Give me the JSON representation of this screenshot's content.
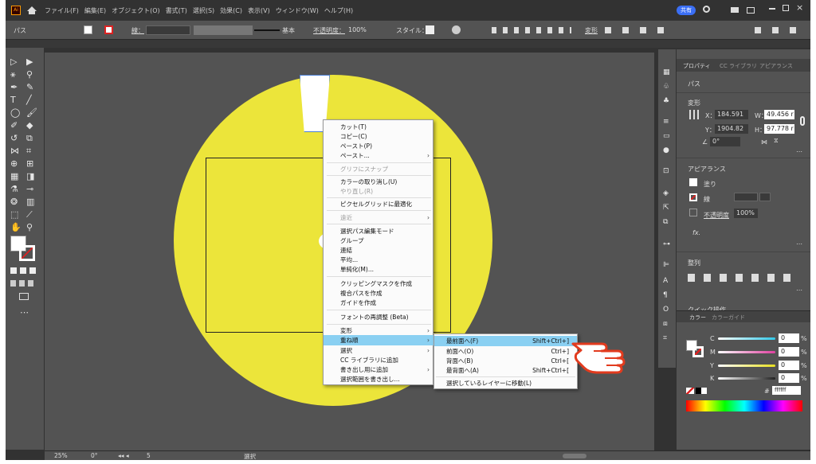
{
  "menubar": {
    "app_badge": "Ai",
    "items": [
      "ファイル(F)",
      "編集(E)",
      "オブジェクト(O)",
      "書式(T)",
      "選択(S)",
      "効果(C)",
      "表示(V)",
      "ウィンドウ(W)",
      "ヘルプ(H)"
    ],
    "share_label": "共有"
  },
  "control_bar": {
    "selection_type": "パス",
    "stroke_label": "線：",
    "stroke_style": "基本",
    "opacity_label": "不透明度：",
    "opacity_value": "100%",
    "style_label": "スタイル：",
    "transform_label": "変形"
  },
  "context_menu": {
    "items": [
      {
        "label": "カット(T)",
        "disabled": false,
        "submenu": false
      },
      {
        "label": "コピー(C)",
        "disabled": false,
        "submenu": false
      },
      {
        "label": "ペースト(P)",
        "disabled": false,
        "submenu": false
      },
      {
        "label": "ペースト...",
        "disabled": false,
        "submenu": true
      },
      {
        "label": "グリフにスナップ",
        "disabled": true,
        "submenu": false
      },
      {
        "label": "カラーの取り消し(U)",
        "disabled": false,
        "submenu": false
      },
      {
        "label": "やり直し(R)",
        "disabled": true,
        "submenu": false
      },
      {
        "label": "ピクセルグリッドに最適化",
        "disabled": false,
        "submenu": false
      },
      {
        "label": "遠近",
        "disabled": true,
        "submenu": true
      },
      {
        "label": "選択パス編集モード",
        "disabled": false,
        "submenu": false
      },
      {
        "label": "グループ",
        "disabled": false,
        "submenu": false
      },
      {
        "label": "連結",
        "disabled": false,
        "submenu": false
      },
      {
        "label": "平均...",
        "disabled": false,
        "submenu": false
      },
      {
        "label": "単純化(M)...",
        "disabled": false,
        "submenu": false
      },
      {
        "label": "クリッピングマスクを作成",
        "disabled": false,
        "submenu": false
      },
      {
        "label": "複合パスを作成",
        "disabled": false,
        "submenu": false
      },
      {
        "label": "ガイドを作成",
        "disabled": false,
        "submenu": false
      },
      {
        "label": "フォントの再調整 (Beta)",
        "disabled": false,
        "submenu": false
      },
      {
        "label": "変形",
        "disabled": false,
        "submenu": true
      },
      {
        "label": "重ね順",
        "disabled": false,
        "submenu": true,
        "selected": true
      },
      {
        "label": "選択",
        "disabled": false,
        "submenu": true
      },
      {
        "label": "CC ライブラリに追加",
        "disabled": false,
        "submenu": false
      },
      {
        "label": "書き出し用に追加",
        "disabled": false,
        "submenu": true
      },
      {
        "label": "選択範囲を書き出し...",
        "disabled": false,
        "submenu": false
      }
    ]
  },
  "submenu": {
    "items": [
      {
        "label": "最前面へ(F)",
        "shortcut": "Shift+Ctrl+]",
        "selected": true
      },
      {
        "label": "前面へ(O)",
        "shortcut": "Ctrl+]"
      },
      {
        "label": "背面へ(B)",
        "shortcut": "Ctrl+["
      },
      {
        "label": "最背面へ(A)",
        "shortcut": "Shift+Ctrl+["
      },
      {
        "label": "選択しているレイヤーに移動(L)",
        "shortcut": ""
      }
    ]
  },
  "properties_panel": {
    "tabs": [
      "プロパティ",
      "CC ライブラリ",
      "アピアランス"
    ],
    "section_path": "パス",
    "section_transform": "変形",
    "x_label": "X：",
    "x_value": "184.591",
    "y_label": "Y：",
    "y_value": "1904.82",
    "w_label": "W：",
    "w_value": "49.456 r",
    "h_label": "H：",
    "h_value": "97.778 r",
    "angle_value": "0°",
    "section_appearance": "アピアランス",
    "fill_label": "塗り",
    "stroke_label": "線",
    "opacity_label": "不透明度",
    "opacity_value": "100%",
    "fx_label": "fx.",
    "section_align": "整列",
    "quick_actions": "クイック操作"
  },
  "color_panel": {
    "tabs": [
      "カラー",
      "カラーガイド"
    ],
    "channels": [
      {
        "label": "C",
        "value": "0",
        "unit": "%",
        "color": "#30c8e8"
      },
      {
        "label": "M",
        "value": "0",
        "unit": "%",
        "color": "#e040a0"
      },
      {
        "label": "Y",
        "value": "0",
        "unit": "%",
        "color": "#e8e020"
      },
      {
        "label": "K",
        "value": "0",
        "unit": "%",
        "color": "#bbbbbb"
      }
    ],
    "hex_value": "ffffff"
  },
  "status_bar": {
    "zoom": "25%",
    "rotation": "0°",
    "artboard": "5",
    "mode": "選択"
  }
}
